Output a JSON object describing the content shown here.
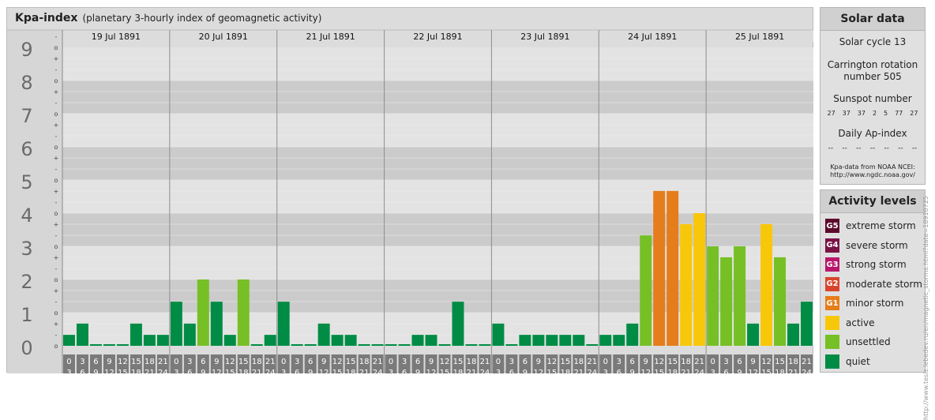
{
  "header": {
    "title": "Kpa-index",
    "subtitle": "(planetary 3-hourly index of geomagnetic activity)"
  },
  "solar": {
    "heading": "Solar data",
    "cycle": "Solar cycle 13",
    "carrington_line1": "Carrington rotation",
    "carrington_line2": "number 505",
    "sunspot_label": "Sunspot number",
    "sunspot_values": [
      "27",
      "37",
      "37",
      "2",
      "5",
      "77",
      "27"
    ],
    "ap_label": "Daily Ap-index",
    "ap_values": [
      "--",
      "--",
      "--",
      "--",
      "--",
      "--",
      "--"
    ],
    "source_line1": "Kpa-data from NOAA NCEI:",
    "source_line2": "http://www.ngdc.noaa.gov/"
  },
  "activity": {
    "heading": "Activity levels",
    "levels": [
      {
        "code": "G5",
        "label": "extreme storm",
        "color": "#5c0a2e"
      },
      {
        "code": "G4",
        "label": "severe storm",
        "color": "#7a1446"
      },
      {
        "code": "G3",
        "label": "strong storm",
        "color": "#b8176b"
      },
      {
        "code": "G2",
        "label": "moderate storm",
        "color": "#d9452c"
      },
      {
        "code": "G1",
        "label": "minor storm",
        "color": "#e57d1a"
      },
      {
        "code": "",
        "label": "active",
        "color": "#f8c70a"
      },
      {
        "code": "",
        "label": "unsettled",
        "color": "#76c026"
      },
      {
        "code": "",
        "label": "quiet",
        "color": "#008c45"
      }
    ]
  },
  "credit": "http://www.tesis.lebedev.ru/en/magnetic_storms.html?date=18910725",
  "chart_data": {
    "type": "bar",
    "days": [
      "19 Jul 1891",
      "20 Jul 1891",
      "21 Jul 1891",
      "22 Jul 1891",
      "23 Jul 1891",
      "24 Jul 1891",
      "25 Jul 1891"
    ],
    "interval_start": [
      "0",
      "3",
      "6",
      "9",
      "12",
      "15",
      "18",
      "21"
    ],
    "interval_end": [
      "3",
      "6",
      "9",
      "12",
      "15",
      "18",
      "21",
      "24"
    ],
    "y_ticks": [
      "0",
      "1",
      "2",
      "3",
      "4",
      "5",
      "6",
      "7",
      "8",
      "9"
    ],
    "y_subticks": [
      "o",
      "-",
      "+",
      "o",
      "-",
      "+",
      "o",
      "-",
      "+",
      "o",
      "-",
      "+",
      "o",
      "-",
      "+",
      "o",
      "-",
      "+",
      "o",
      "-",
      "+",
      "o",
      "-",
      "+",
      "o",
      "-",
      "+",
      "o",
      "-"
    ],
    "ylim": [
      0,
      9
    ],
    "values": [
      [
        0.33,
        0.67,
        0,
        0,
        0,
        0.67,
        0.33,
        0.33
      ],
      [
        1.33,
        0.67,
        2.0,
        1.33,
        0.33,
        2.0,
        0,
        0.33
      ],
      [
        1.33,
        0,
        0,
        0.67,
        0.33,
        0.33,
        0,
        0
      ],
      [
        0,
        0,
        0.33,
        0.33,
        0,
        1.33,
        0,
        0
      ],
      [
        0.67,
        0,
        0.33,
        0.33,
        0.33,
        0.33,
        0.33,
        0
      ],
      [
        0.33,
        0.33,
        0.67,
        3.33,
        4.67,
        4.67,
        3.67,
        4.0
      ],
      [
        3.0,
        2.67,
        3.0,
        0.67,
        3.67,
        2.67,
        0.67,
        1.33
      ]
    ],
    "level_colors": {
      "quiet": "#008c45",
      "unsettled": "#76c026",
      "active": "#f8c70a",
      "minor": "#e57d1a"
    }
  }
}
